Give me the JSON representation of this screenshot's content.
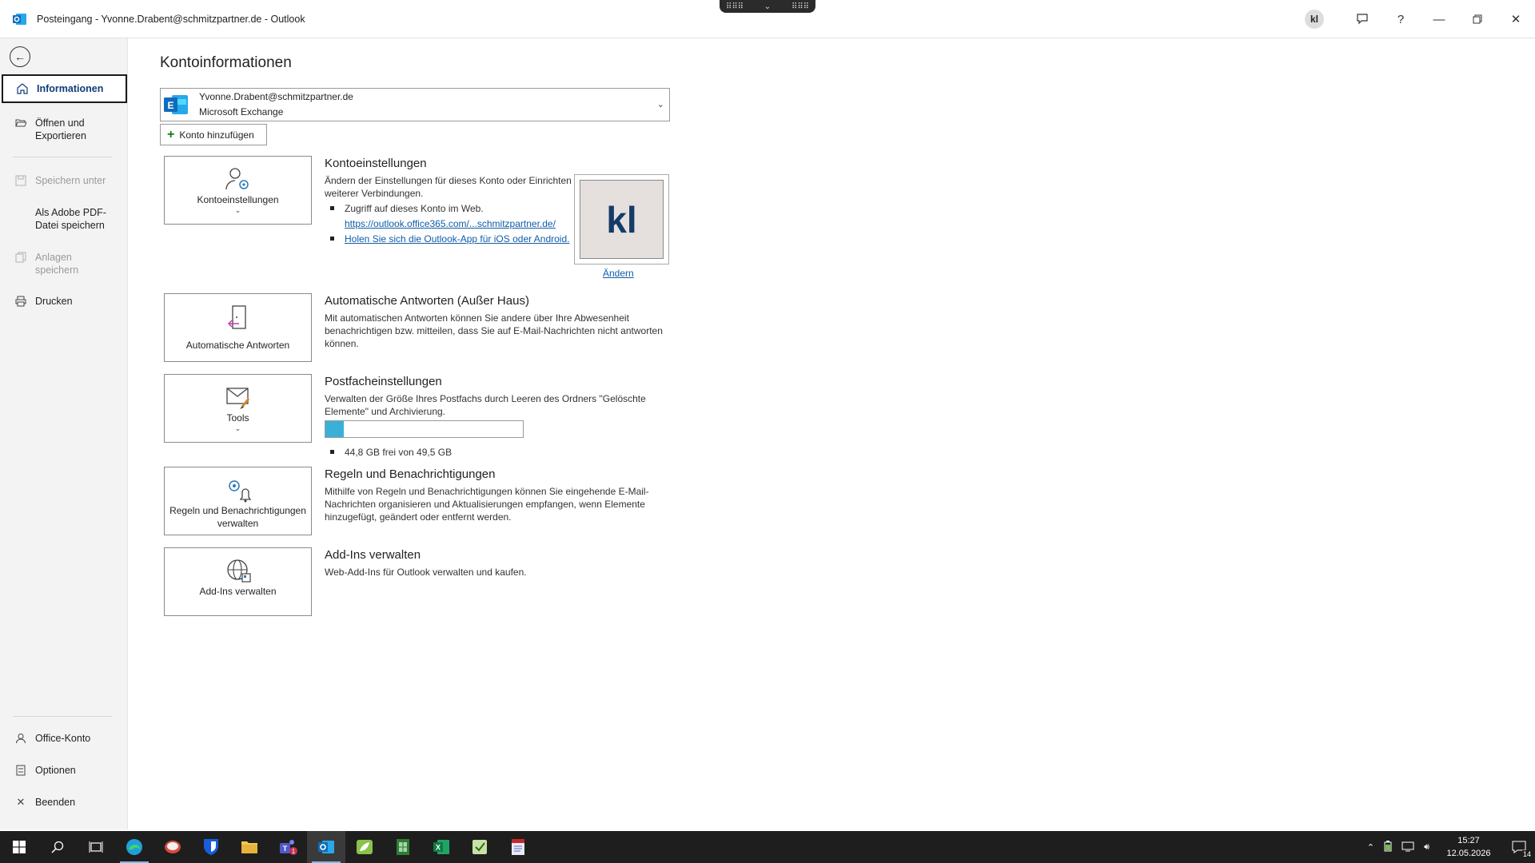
{
  "window": {
    "title": "Posteingang - Yvonne.Drabent@schmitzpartner.de  -  Outlook",
    "user_initials": "kl"
  },
  "sidebar": {
    "items": [
      {
        "label": "Informationen",
        "icon": "home-icon",
        "active": true
      },
      {
        "label": "Öffnen und Exportieren",
        "icon": "folder-open-icon"
      },
      {
        "label": "Speichern unter",
        "icon": "save-as-icon",
        "disabled": true
      },
      {
        "label": "Als Adobe PDF-Datei speichern",
        "icon": "pdf-icon"
      },
      {
        "label": "Anlagen speichern",
        "icon": "attachments-icon",
        "disabled": true
      },
      {
        "label": "Drucken",
        "icon": "printer-icon"
      }
    ],
    "bottom": [
      {
        "label": "Office-Konto",
        "icon": "person-icon"
      },
      {
        "label": "Optionen",
        "icon": "options-icon"
      },
      {
        "label": "Beenden",
        "icon": "close-icon"
      }
    ]
  },
  "main": {
    "title": "Kontoinformationen",
    "account": {
      "email": "Yvonne.Drabent@schmitzpartner.de",
      "type": "Microsoft Exchange"
    },
    "add_account_label": "Konto hinzufügen",
    "sections": {
      "account_settings": {
        "tile_label": "Kontoeinstellungen",
        "heading": "Kontoeinstellungen",
        "description": "Ändern der Einstellungen für dieses Konto oder Einrichten weiterer Verbindungen.",
        "bullet1": "Zugriff auf dieses Konto im Web.",
        "web_link": "https://outlook.office365.com/...schmitzpartner.de/",
        "app_link": "Holen Sie sich die Outlook-App für iOS oder Android.",
        "profile_initials": "kl",
        "change_link": "Ändern"
      },
      "auto_replies": {
        "tile_label": "Automatische Antworten",
        "heading": "Automatische Antworten (Außer Haus)",
        "description": "Mit automatischen Antworten können Sie andere über Ihre Abwesenheit benachrichtigen bzw. mitteilen, dass Sie auf E-Mail-Nachrichten nicht antworten können."
      },
      "mailbox": {
        "tile_label": "Tools",
        "heading": "Postfacheinstellungen",
        "description": "Verwalten der Größe Ihres Postfachs durch Leeren des Ordners \"Gelöschte Elemente\" und Archivierung.",
        "storage_text": "44,8 GB frei von 49,5 GB",
        "used_fraction": 0.095
      },
      "rules": {
        "tile_label": "Regeln und Benachrichtigungen verwalten",
        "heading": "Regeln und Benachrichtigungen",
        "description": "Mithilfe von Regeln und Benachrichtigungen können Sie eingehende E-Mail-Nachrichten organisieren und Aktualisierungen empfangen, wenn Elemente hinzugefügt, geändert oder entfernt werden."
      },
      "addins": {
        "tile_label": "Add-Ins verwalten",
        "heading": "Add-Ins verwalten",
        "description": "Web-Add-Ins für Outlook verwalten und kaufen."
      }
    }
  },
  "taskbar": {
    "time": "15:27",
    "date": "12.05.2026",
    "notification_count": "14",
    "colors": {
      "background": "#1e1e1e",
      "accent": "#0f6cbd"
    }
  }
}
